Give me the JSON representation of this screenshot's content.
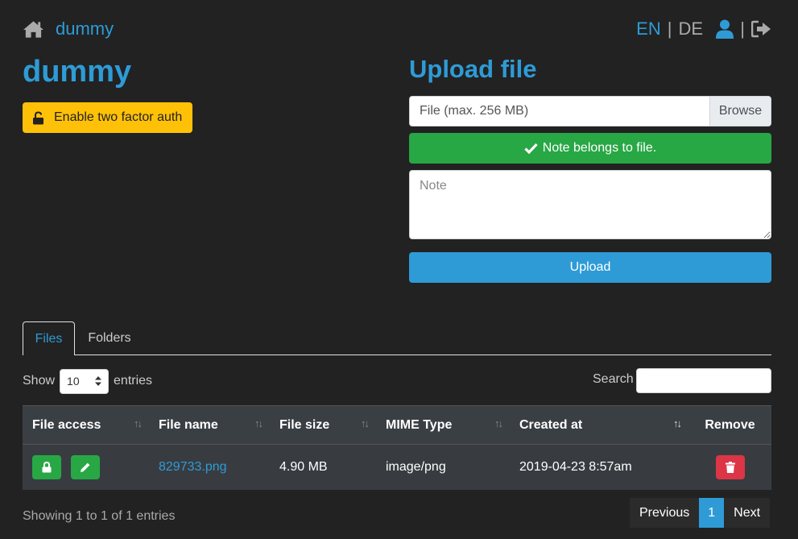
{
  "header": {
    "brand": "dummy",
    "lang_en": "EN",
    "lang_sep": "|",
    "lang_de": "DE",
    "icon_sep": "|"
  },
  "profile": {
    "title": "dummy",
    "tfa_label": "Enable two factor auth"
  },
  "upload": {
    "title": "Upload file",
    "file_placeholder": "File (max. 256 MB)",
    "browse_label": "Browse",
    "note_status": "Note belongs to file.",
    "note_placeholder": "Note",
    "upload_label": "Upload"
  },
  "tabs": {
    "files": "Files",
    "folders": "Folders"
  },
  "table_controls": {
    "show_label": "Show",
    "entries_value": "10",
    "entries_label": "entries",
    "search_label": "Search"
  },
  "table": {
    "columns": [
      "File access",
      "File name",
      "File size",
      "MIME Type",
      "Created at",
      "Remove"
    ],
    "rows": [
      {
        "file_name": "829733.png",
        "file_size": "4.90 MB",
        "mime": "image/png",
        "created": "2019-04-23 8:57am"
      }
    ]
  },
  "footer": {
    "info": "Showing 1 to 1 of 1 entries",
    "prev": "Previous",
    "page": "1",
    "next": "Next"
  },
  "colors": {
    "background": "#222222",
    "accent": "#2e9bd6",
    "success": "#28a745",
    "warning": "#ffc107",
    "danger": "#dc3545"
  }
}
